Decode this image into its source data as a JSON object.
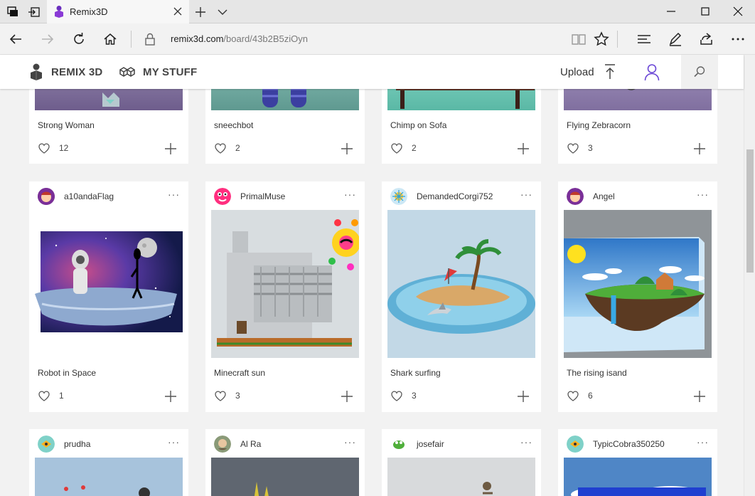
{
  "browser": {
    "tab_title": "Remix3D",
    "url_host": "remix3d.com",
    "url_path": "/board/43b2B5ziOyn"
  },
  "header": {
    "brand": "REMIX 3D",
    "my_stuff": "MY STUFF",
    "upload": "Upload"
  },
  "colors": {
    "accent": "#5c2d91",
    "user_icon": "#6b47d6"
  },
  "rows": [
    {
      "cards": [
        {
          "title": "Strong Woman",
          "likes": "12"
        },
        {
          "title": "sneechbot",
          "likes": "2"
        },
        {
          "title": "Chimp on Sofa",
          "likes": "2"
        },
        {
          "title": "Flying Zebracorn",
          "likes": "3"
        }
      ]
    },
    {
      "cards": [
        {
          "owner": "a10andaFlag",
          "title": "Robot in Space",
          "likes": "1"
        },
        {
          "owner": "PrimalMuse",
          "title": "Minecraft sun",
          "likes": "3"
        },
        {
          "owner": "DemandedCorgi752",
          "title": "Shark surfing",
          "likes": "3"
        },
        {
          "owner": "Angel",
          "title": "The rising isand",
          "likes": "6"
        }
      ]
    },
    {
      "cards": [
        {
          "owner": "prudha"
        },
        {
          "owner": "Al Ra"
        },
        {
          "owner": "josefair"
        },
        {
          "owner": "TypicCobra350250"
        }
      ]
    }
  ]
}
